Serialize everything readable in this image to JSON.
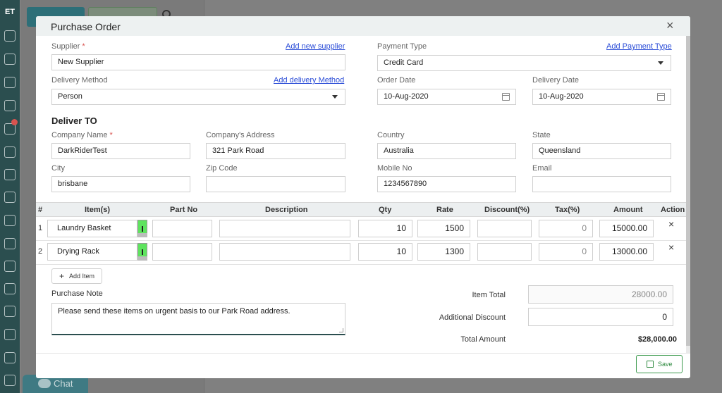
{
  "app": {
    "logo": "ET"
  },
  "chat": {
    "label": "Chat"
  },
  "modal": {
    "title": "Purchase Order",
    "close_icon": "×",
    "supplier": {
      "label": "Supplier",
      "required": "*",
      "link": "Add new supplier",
      "value": "New Supplier"
    },
    "payment_type": {
      "label": "Payment Type",
      "link": "Add Payment Type",
      "value": "Credit Card"
    },
    "delivery_method": {
      "label": "Delivery Method",
      "link": "Add delivery Method",
      "value": "Person"
    },
    "order_date": {
      "label": "Order Date",
      "value": "10-Aug-2020"
    },
    "delivery_date": {
      "label": "Delivery Date",
      "value": "10-Aug-2020"
    },
    "deliver_to": {
      "title": "Deliver TO",
      "company_name": {
        "label": "Company Name",
        "required": "*",
        "value": "DarkRiderTest"
      },
      "company_address": {
        "label": "Company's Address",
        "value": "321 Park Road"
      },
      "country": {
        "label": "Country",
        "value": "Australia"
      },
      "state": {
        "label": "State",
        "value": "Queensland"
      },
      "city": {
        "label": "City",
        "value": "brisbane"
      },
      "zip": {
        "label": "Zip Code",
        "value": ""
      },
      "mobile": {
        "label": "Mobile No",
        "value": "1234567890"
      },
      "email": {
        "label": "Email",
        "value": ""
      }
    },
    "table": {
      "headers": [
        "#",
        "Item(s)",
        "Part No",
        "Description",
        "Qty",
        "Rate",
        "Discount(%)",
        "Tax(%)",
        "Amount",
        "Action"
      ],
      "rows": [
        {
          "num": "1",
          "item": "Laundry Basket",
          "part_no": "",
          "description": "",
          "qty": "10",
          "rate": "1500",
          "discount": "",
          "tax": "0",
          "amount": "15000.00",
          "action": "×"
        },
        {
          "num": "2",
          "item": "Drying Rack",
          "part_no": "",
          "description": "",
          "qty": "10",
          "rate": "1300",
          "discount": "",
          "tax": "0",
          "amount": "13000.00",
          "action": "×"
        }
      ]
    },
    "add_item": "Add Item",
    "purchase_note": {
      "label": "Purchase Note",
      "value": "Please send these items on urgent basis to our Park Road address."
    },
    "totals": {
      "item_total_label": "Item Total",
      "item_total": "28000.00",
      "discount_label": "Additional Discount",
      "discount": "0",
      "total_label": "Total Amount",
      "total": "$28,000.00"
    },
    "save": "Save"
  }
}
